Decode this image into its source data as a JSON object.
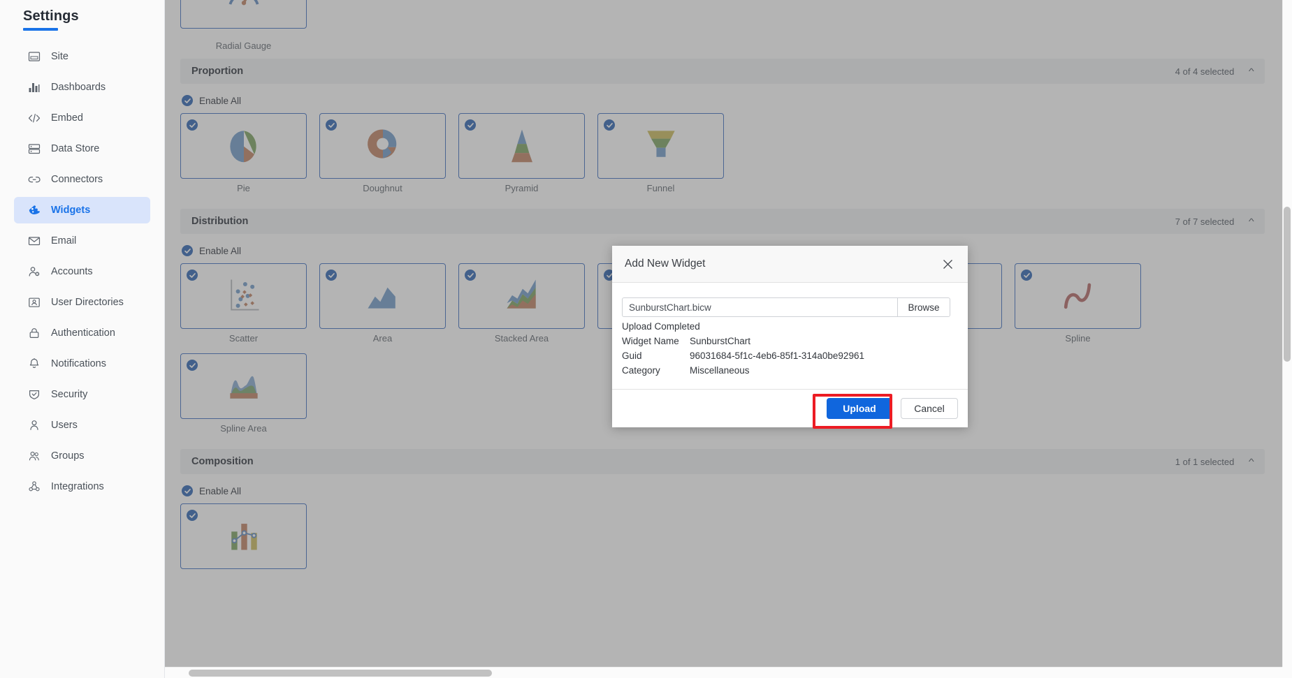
{
  "sidebar": {
    "title": "Settings",
    "items": [
      {
        "label": "Site",
        "icon": "site-icon",
        "active": false
      },
      {
        "label": "Dashboards",
        "icon": "dashboards-icon",
        "active": false
      },
      {
        "label": "Embed",
        "icon": "embed-code-icon",
        "active": false
      },
      {
        "label": "Data Store",
        "icon": "data-store-icon",
        "active": false
      },
      {
        "label": "Connectors",
        "icon": "connectors-link-icon",
        "active": false
      },
      {
        "label": "Widgets",
        "icon": "widgets-icon",
        "active": true
      },
      {
        "label": "Email",
        "icon": "email-envelope-icon",
        "active": false
      },
      {
        "label": "Accounts",
        "icon": "accounts-icon",
        "active": false
      },
      {
        "label": "User Directories",
        "icon": "user-directories-icon",
        "active": false
      },
      {
        "label": "Authentication",
        "icon": "lock-icon",
        "active": false
      },
      {
        "label": "Notifications",
        "icon": "bell-icon",
        "active": false
      },
      {
        "label": "Security",
        "icon": "shield-icon",
        "active": false
      },
      {
        "label": "Users",
        "icon": "user-icon",
        "active": false
      },
      {
        "label": "Groups",
        "icon": "groups-icon",
        "active": false
      },
      {
        "label": "Integrations",
        "icon": "integrations-icon",
        "active": false
      }
    ]
  },
  "main": {
    "top_partial_card": {
      "label": "Radial Gauge",
      "glyph": "radial-gauge"
    },
    "enable_all_label": "Enable All",
    "sections": [
      {
        "name": "Proportion",
        "selected_text": "4 of 4 selected",
        "collapse_icon": "chevron-up-icon",
        "cards": [
          {
            "label": "Pie",
            "glyph": "pie",
            "checked": true
          },
          {
            "label": "Doughnut",
            "glyph": "doughnut",
            "checked": true
          },
          {
            "label": "Pyramid",
            "glyph": "pyramid",
            "checked": true
          },
          {
            "label": "Funnel",
            "glyph": "funnel",
            "checked": true
          }
        ]
      },
      {
        "name": "Distribution",
        "selected_text": "7 of 7 selected",
        "collapse_icon": "chevron-up-icon",
        "cards": [
          {
            "label": "Scatter",
            "glyph": "scatter",
            "checked": true
          },
          {
            "label": "Area",
            "glyph": "area",
            "checked": true
          },
          {
            "label": "Stacked Area",
            "glyph": "stacked-area",
            "checked": true
          },
          {
            "label": "",
            "glyph": "hidden",
            "checked": true
          },
          {
            "label": "",
            "glyph": "hidden",
            "checked": true
          },
          {
            "label": "",
            "glyph": "hidden",
            "checked": true
          },
          {
            "label": "Spline",
            "glyph": "spline",
            "checked": true
          },
          {
            "label": "Spline Area",
            "glyph": "spline-area",
            "checked": true
          }
        ]
      },
      {
        "name": "Composition",
        "selected_text": "1 of 1 selected",
        "collapse_icon": "chevron-up-icon",
        "cards": [
          {
            "label": "",
            "glyph": "combo",
            "checked": true
          }
        ]
      }
    ]
  },
  "modal": {
    "title": "Add New Widget",
    "close_icon": "close-icon",
    "file_value": "SunburstChart.bicw",
    "file_placeholder": "",
    "browse_label": "Browse",
    "status": "Upload Completed",
    "fields": [
      {
        "key": "Widget Name",
        "value": "SunburstChart"
      },
      {
        "key": "Guid",
        "value": "96031684-5f1c-4eb6-85f1-314a0be92961"
      },
      {
        "key": "Category",
        "value": "Miscellaneous"
      }
    ],
    "upload_label": "Upload",
    "cancel_label": "Cancel"
  },
  "colors": {
    "accent": "#1a73e8",
    "sidebar_active_bg": "#d9e4fb",
    "card_border": "#4a78c4",
    "check_blue": "#3b6fb8",
    "upload_blue": "#1066dd",
    "highlight_red": "#ec1c24"
  }
}
